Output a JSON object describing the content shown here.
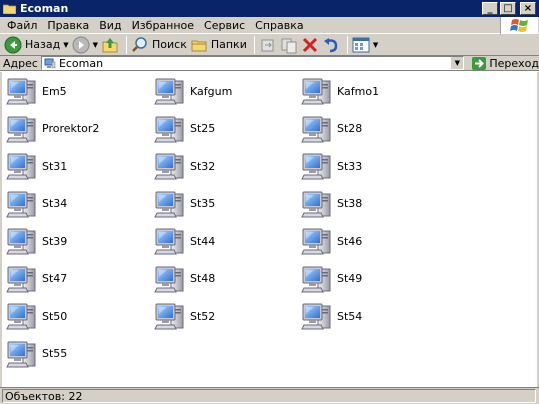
{
  "window": {
    "title": "Ecoman",
    "icon": "folder-icon",
    "controls": {
      "minimize": "_",
      "maximize": "□",
      "close": "×"
    }
  },
  "menu": {
    "items": [
      "Файл",
      "Правка",
      "Вид",
      "Избранное",
      "Сервис",
      "Справка"
    ]
  },
  "toolbar": {
    "back_label": "Назад",
    "search_label": "Поиск",
    "folders_label": "Папки"
  },
  "address": {
    "label": "Адрес",
    "value": "Ecoman",
    "go_label": "Переход"
  },
  "computers": [
    "Em5",
    "Kafgum",
    "Kafmo1",
    "Prorektor2",
    "St25",
    "St28",
    "St31",
    "St32",
    "St33",
    "St34",
    "St35",
    "St38",
    "St39",
    "St44",
    "St46",
    "St47",
    "St48",
    "St49",
    "St50",
    "St52",
    "St54",
    "St55"
  ],
  "status": {
    "text": "Объектов: 22"
  },
  "colors": {
    "titlebar": "#0a246a",
    "chrome": "#d4d0c8",
    "content_bg": "#ffffff"
  }
}
